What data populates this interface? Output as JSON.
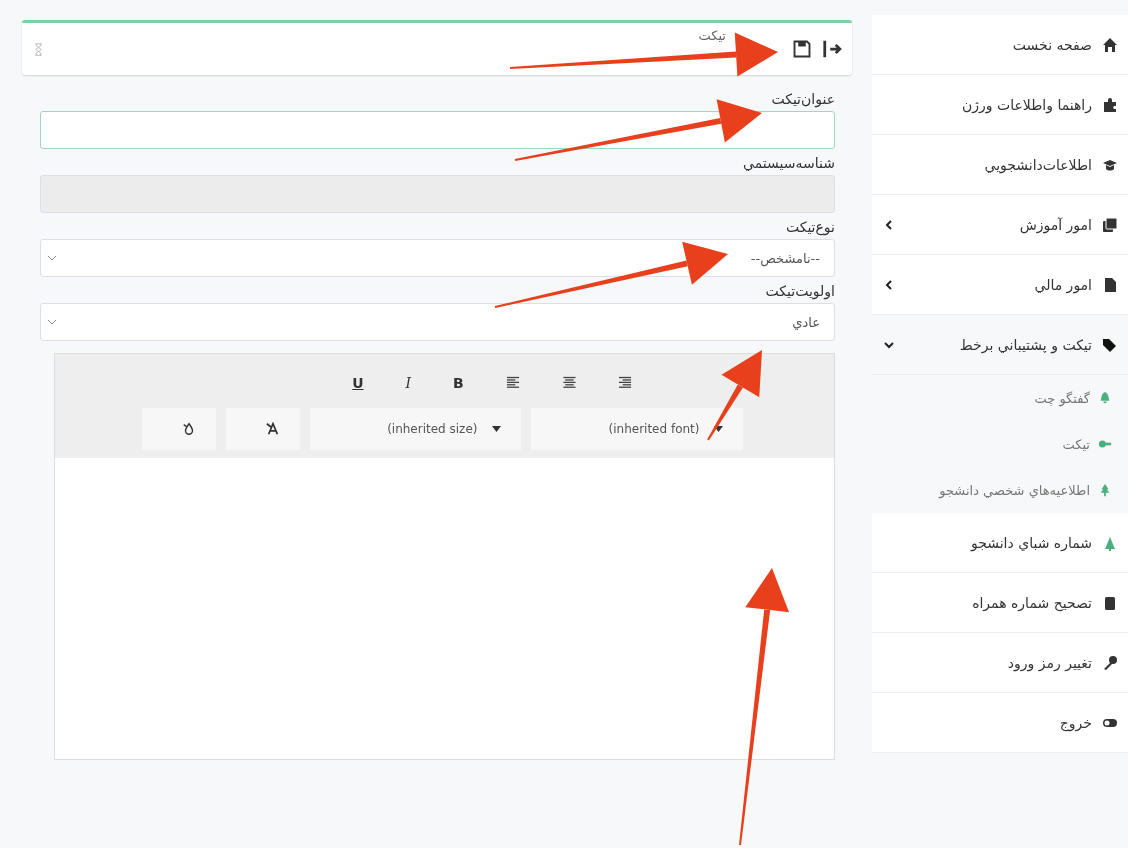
{
  "header": {
    "title": "تیکت"
  },
  "form": {
    "fields": [
      {
        "kind": "text",
        "label": "عنوان‌تیکت",
        "focused": true
      },
      {
        "kind": "disabled",
        "label": "شناسه‌سیستمي"
      },
      {
        "kind": "select",
        "label": "نوع‌تیکت",
        "value": "--نامشخص--"
      },
      {
        "kind": "select",
        "label": "اولویت‌تیکت",
        "value": "عادي"
      }
    ]
  },
  "editor": {
    "format_buttons": [
      "B",
      "I",
      "U"
    ],
    "size_select": "(inherited size)",
    "font_select": "(inherited font)"
  },
  "sidebar": {
    "items": [
      {
        "label": "صفحه نخست"
      },
      {
        "label": "راهنما واطلاعات ورژن"
      },
      {
        "label": "اطلاعات‌دانشجويي"
      },
      {
        "label": "امور آموزش",
        "expanded": false
      },
      {
        "label": "امور مالي",
        "expanded": false
      },
      {
        "label": "تیکت و پشتيباني برخط",
        "expanded": true,
        "children": [
          {
            "label": "گفتگو چت"
          },
          {
            "label": "تیکت"
          },
          {
            "label": "اطلاعیه‌هاي شخصي دانشجو"
          }
        ]
      },
      {
        "label": "شماره شباي دانشجو"
      },
      {
        "label": "تصحیح شماره همراه"
      },
      {
        "label": "تغيير رمز ورود"
      },
      {
        "label": "خروج"
      }
    ]
  }
}
